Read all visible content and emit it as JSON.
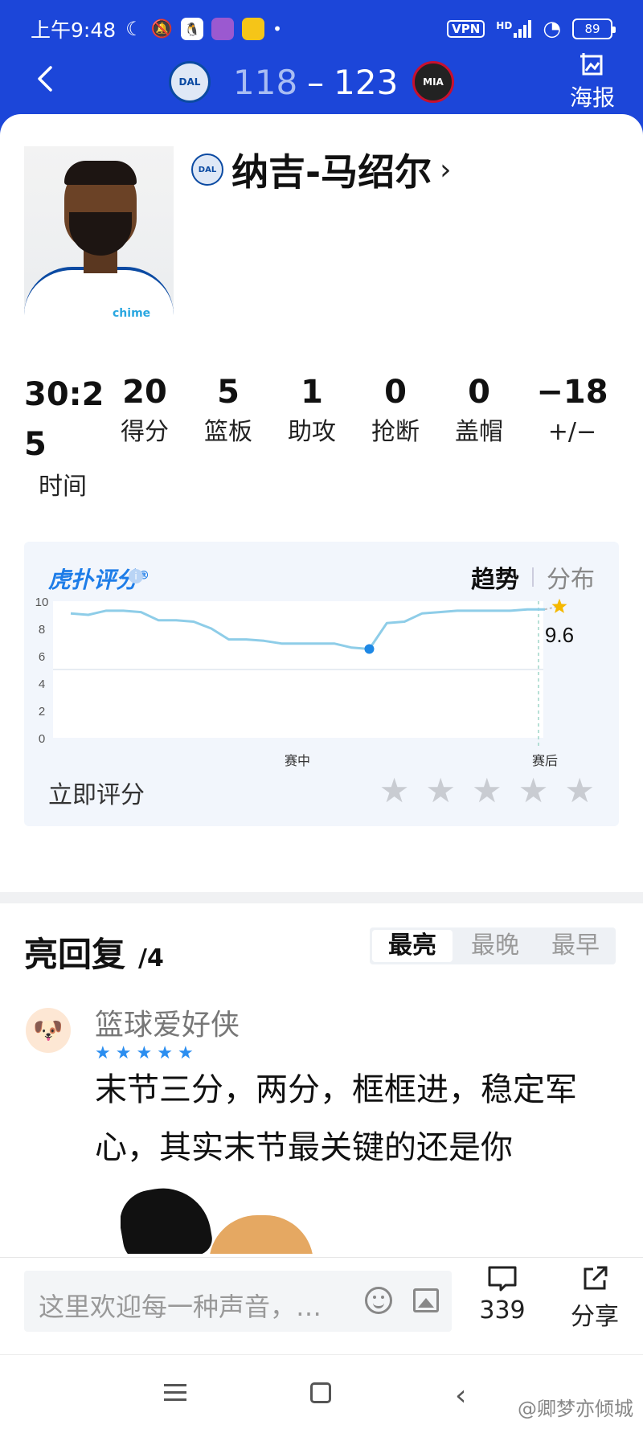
{
  "status_bar": {
    "time": "上午9:48",
    "vpn": "VPN",
    "hd": "HD",
    "battery": "89"
  },
  "header": {
    "home_team_abbr": "DAL",
    "away_team_abbr": "MIA",
    "home_score": "118",
    "separator": "–",
    "away_score": "123",
    "poster_label": "海报"
  },
  "player": {
    "name": "纳吉-马绍尔",
    "team_abbr": "DAL",
    "jersey_text": "chime"
  },
  "stats": [
    {
      "value": "30:25",
      "label": "时间"
    },
    {
      "value": "20",
      "label": "得分"
    },
    {
      "value": "5",
      "label": "篮板"
    },
    {
      "value": "1",
      "label": "助攻"
    },
    {
      "value": "0",
      "label": "抢断"
    },
    {
      "value": "0",
      "label": "盖帽"
    },
    {
      "value": "−18",
      "label": "+/−"
    }
  ],
  "rating": {
    "brand": "虎扑评分",
    "reg_mark": "®",
    "tab_active": "趋势",
    "tab_inactive": "分布",
    "current_score": "9.6",
    "rate_now_label": "立即评分",
    "user_stars": 0
  },
  "chart_data": {
    "type": "line",
    "ylim": [
      0,
      10
    ],
    "yticks": [
      "10",
      "8",
      "6",
      "4",
      "2",
      "0"
    ],
    "xtick_labels": [
      "赛中",
      "赛后"
    ],
    "values": [
      9.1,
      9.0,
      9.3,
      9.3,
      9.2,
      8.6,
      8.6,
      8.5,
      8.0,
      7.2,
      7.2,
      7.1,
      6.9,
      6.9,
      6.9,
      6.9,
      6.6,
      6.5,
      8.4,
      8.5,
      9.1,
      9.2,
      9.3,
      9.3,
      9.3,
      9.3,
      9.4,
      9.4
    ],
    "highlight_point": {
      "index": 17,
      "value": 6.5
    },
    "final_value": 9.6,
    "colors": {
      "line": "#8ecde8",
      "point": "#1e88e5",
      "star": "#f5b800"
    }
  },
  "replies": {
    "title": "亮回复",
    "count": "/4",
    "sort_tabs": [
      "最亮",
      "最晚",
      "最早"
    ],
    "active_sort": "最亮",
    "items": [
      {
        "user": "篮球爱好侠",
        "stars": 5,
        "text": "末节三分，两分，框框进，稳定军心，其实末节最关键的还是你"
      }
    ]
  },
  "bottom_bar": {
    "comment_placeholder": "这里欢迎每一种声音，…",
    "comment_count": "339",
    "share_label": "分享"
  },
  "watermark": "@卿梦亦倾城",
  "colors": {
    "header_blue": "#1c46d9",
    "score_faded": "#a9bdf3",
    "accent_blue": "#2b8ef0"
  }
}
